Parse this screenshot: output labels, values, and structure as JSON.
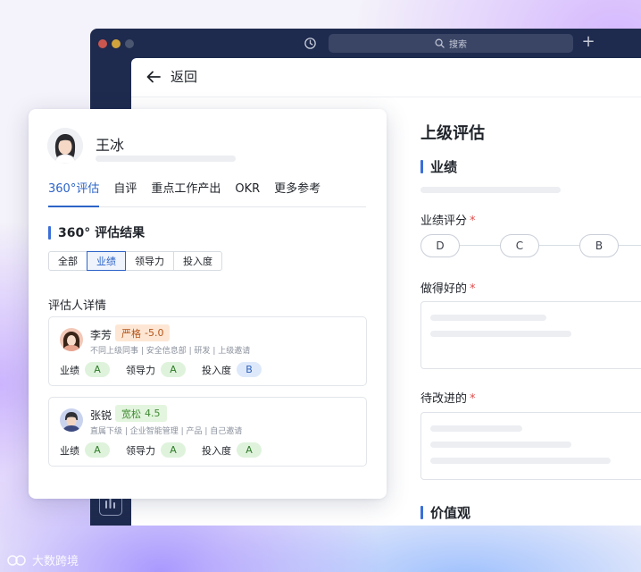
{
  "browser": {
    "search_placeholder": "搜索",
    "history_icon": "history-icon",
    "new_tab_icon": "plus-icon"
  },
  "header": {
    "back_label": "返回"
  },
  "evaluation": {
    "title": "上级评估",
    "performance_section": "业绩",
    "performance_score_label": "业绩评分",
    "grades": [
      "D",
      "C",
      "B"
    ],
    "did_well_label": "做得好的",
    "to_improve_label": "待改进的",
    "values_section": "价值观",
    "required_mark": "*"
  },
  "profile_card": {
    "name": "王冰",
    "tabs": [
      "360°评估",
      "自评",
      "重点工作产出",
      "OKR",
      "更多参考"
    ],
    "active_tab": 0,
    "result_title": "360° 评估结果",
    "filters": [
      "全部",
      "业绩",
      "领导力",
      "投入度"
    ],
    "active_filter": 1,
    "raters_title": "评估人详情",
    "raters": [
      {
        "name": "李芳",
        "tag_label": "严格",
        "tag_value": "-5.0",
        "tag_type": "strict",
        "meta": "不同上级同事 | 安全信息部 | 研发 | 上级邀请",
        "scores": [
          {
            "label": "业绩",
            "grade": "A"
          },
          {
            "label": "领导力",
            "grade": "A"
          },
          {
            "label": "投入度",
            "grade": "B"
          }
        ]
      },
      {
        "name": "张锐",
        "tag_label": "宽松",
        "tag_value": "4.5",
        "tag_type": "loose",
        "meta": "直属下级 | 企业智能管理 | 产品 | 自己邀请",
        "scores": [
          {
            "label": "业绩",
            "grade": "A"
          },
          {
            "label": "领导力",
            "grade": "A"
          },
          {
            "label": "投入度",
            "grade": "A"
          }
        ]
      }
    ]
  },
  "watermark": {
    "text": "大数跨境"
  },
  "colors": {
    "accent": "#2d64c8",
    "sidebar": "#1e2a4e",
    "required": "#e34d4d"
  }
}
